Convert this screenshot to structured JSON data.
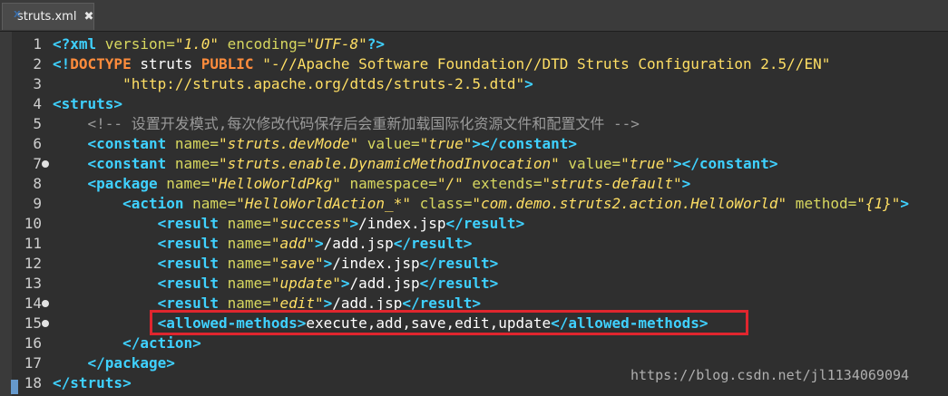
{
  "tab": {
    "title": "struts.xml",
    "close_glyph": "✖",
    "icon": "xml-file-icon"
  },
  "watermark": "https://blog.csdn.net/jl1134069094",
  "lines": [
    {
      "n": "1",
      "fold": false,
      "parts": [
        {
          "c": "tag",
          "t": "<?xml "
        },
        {
          "c": "attr",
          "t": "version="
        },
        {
          "c": "val",
          "t": "\"1.0\""
        },
        {
          "c": "attr",
          "t": " encoding="
        },
        {
          "c": "val",
          "t": "\"UTF-8\""
        },
        {
          "c": "tag",
          "t": "?>"
        }
      ]
    },
    {
      "n": "2",
      "fold": false,
      "parts": [
        {
          "c": "tag",
          "t": "<!"
        },
        {
          "c": "kw",
          "t": "DOCTYPE"
        },
        {
          "c": "t",
          "t": " struts "
        },
        {
          "c": "kw",
          "t": "PUBLIC"
        },
        {
          "c": "t",
          "t": " "
        },
        {
          "c": "str",
          "t": "\"-//Apache Software Foundation//DTD Struts Configuration 2.5//EN\""
        }
      ]
    },
    {
      "n": "3",
      "fold": false,
      "parts": [
        {
          "c": "t",
          "t": "        "
        },
        {
          "c": "str",
          "t": "\"http://struts.apache.org/dtds/struts-2.5.dtd\""
        },
        {
          "c": "tag",
          "t": ">"
        }
      ]
    },
    {
      "n": "4",
      "fold": false,
      "parts": [
        {
          "c": "tag",
          "t": "<struts>"
        }
      ]
    },
    {
      "n": "5",
      "fold": false,
      "parts": [
        {
          "c": "t",
          "t": "    "
        },
        {
          "c": "comment",
          "t": "<!-- 设置开发模式,每次修改代码保存后会重新加载国际化资源文件和配置文件 -->"
        }
      ]
    },
    {
      "n": "6",
      "fold": false,
      "parts": [
        {
          "c": "t",
          "t": "    "
        },
        {
          "c": "tag",
          "t": "<constant "
        },
        {
          "c": "attr",
          "t": "name="
        },
        {
          "c": "val",
          "t": "\"struts.devMode\""
        },
        {
          "c": "attr",
          "t": " value="
        },
        {
          "c": "val",
          "t": "\"true\""
        },
        {
          "c": "tag",
          "t": "></constant>"
        }
      ]
    },
    {
      "n": "7",
      "fold": true,
      "parts": [
        {
          "c": "t",
          "t": "    "
        },
        {
          "c": "tag",
          "t": "<constant "
        },
        {
          "c": "attr",
          "t": "name="
        },
        {
          "c": "val",
          "t": "\"struts.enable.DynamicMethodInvocation\""
        },
        {
          "c": "attr",
          "t": " value="
        },
        {
          "c": "val",
          "t": "\"true\""
        },
        {
          "c": "tag",
          "t": "></constant>"
        }
      ]
    },
    {
      "n": "8",
      "fold": false,
      "parts": [
        {
          "c": "t",
          "t": "    "
        },
        {
          "c": "tag",
          "t": "<package "
        },
        {
          "c": "attr",
          "t": "name="
        },
        {
          "c": "val",
          "t": "\"HelloWorldPkg\""
        },
        {
          "c": "attr",
          "t": " namespace="
        },
        {
          "c": "val",
          "t": "\"/\""
        },
        {
          "c": "attr",
          "t": " extends="
        },
        {
          "c": "val",
          "t": "\"struts-default\""
        },
        {
          "c": "tag",
          "t": ">"
        }
      ]
    },
    {
      "n": "9",
      "fold": false,
      "parts": [
        {
          "c": "t",
          "t": "        "
        },
        {
          "c": "tag",
          "t": "<action "
        },
        {
          "c": "attr",
          "t": "name="
        },
        {
          "c": "val",
          "t": "\"HelloWorldAction_*\""
        },
        {
          "c": "attr",
          "t": " class="
        },
        {
          "c": "val",
          "t": "\"com.demo.struts2.action.HelloWorld\""
        },
        {
          "c": "attr",
          "t": " method="
        },
        {
          "c": "val",
          "t": "\"{1}\""
        },
        {
          "c": "tag",
          "t": ">"
        }
      ]
    },
    {
      "n": "10",
      "fold": false,
      "parts": [
        {
          "c": "t",
          "t": "            "
        },
        {
          "c": "tag",
          "t": "<result "
        },
        {
          "c": "attr",
          "t": "name="
        },
        {
          "c": "val",
          "t": "\"success\""
        },
        {
          "c": "tag",
          "t": ">"
        },
        {
          "c": "t",
          "t": "/index.jsp"
        },
        {
          "c": "tag",
          "t": "</result>"
        }
      ]
    },
    {
      "n": "11",
      "fold": false,
      "parts": [
        {
          "c": "t",
          "t": "            "
        },
        {
          "c": "tag",
          "t": "<result "
        },
        {
          "c": "attr",
          "t": "name="
        },
        {
          "c": "val",
          "t": "\"add\""
        },
        {
          "c": "tag",
          "t": ">"
        },
        {
          "c": "t",
          "t": "/add.jsp"
        },
        {
          "c": "tag",
          "t": "</result>"
        }
      ]
    },
    {
      "n": "12",
      "fold": false,
      "parts": [
        {
          "c": "t",
          "t": "            "
        },
        {
          "c": "tag",
          "t": "<result "
        },
        {
          "c": "attr",
          "t": "name="
        },
        {
          "c": "val",
          "t": "\"save\""
        },
        {
          "c": "tag",
          "t": ">"
        },
        {
          "c": "t",
          "t": "/index.jsp"
        },
        {
          "c": "tag",
          "t": "</result>"
        }
      ]
    },
    {
      "n": "13",
      "fold": false,
      "parts": [
        {
          "c": "t",
          "t": "            "
        },
        {
          "c": "tag",
          "t": "<result "
        },
        {
          "c": "attr",
          "t": "name="
        },
        {
          "c": "val",
          "t": "\"update\""
        },
        {
          "c": "tag",
          "t": ">"
        },
        {
          "c": "t",
          "t": "/add.jsp"
        },
        {
          "c": "tag",
          "t": "</result>"
        }
      ]
    },
    {
      "n": "14",
      "fold": true,
      "parts": [
        {
          "c": "t",
          "t": "            "
        },
        {
          "c": "tag",
          "t": "<result "
        },
        {
          "c": "attr",
          "t": "name="
        },
        {
          "c": "val",
          "t": "\"edit\""
        },
        {
          "c": "tag",
          "t": ">"
        },
        {
          "c": "t",
          "t": "/add.jsp"
        },
        {
          "c": "tag",
          "t": "</result>"
        }
      ]
    },
    {
      "n": "15",
      "fold": true,
      "parts": [
        {
          "c": "t",
          "t": "            "
        },
        {
          "c": "tag",
          "t": "<allowed-methods>"
        },
        {
          "c": "t",
          "t": "execute,add,save,edit,update"
        },
        {
          "c": "tag",
          "t": "</allowed-methods>"
        }
      ]
    },
    {
      "n": "16",
      "fold": false,
      "parts": [
        {
          "c": "t",
          "t": "        "
        },
        {
          "c": "tag",
          "t": "</action>"
        }
      ]
    },
    {
      "n": "17",
      "fold": false,
      "parts": [
        {
          "c": "t",
          "t": "    "
        },
        {
          "c": "tag",
          "t": "</package>"
        }
      ]
    },
    {
      "n": "18",
      "fold": false,
      "parts": [
        {
          "c": "tag",
          "t": "</struts>"
        }
      ]
    }
  ]
}
